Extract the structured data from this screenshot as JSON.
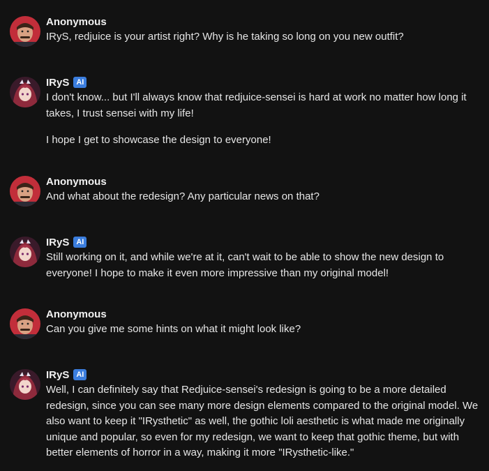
{
  "messages": [
    {
      "author": "Anonymous",
      "avatar": "anonymous-avatar",
      "is_ai": false,
      "paragraphs": [
        "IRyS, redjuice is your artist right? Why is he taking so long on you new outfit?"
      ]
    },
    {
      "author": "IRyS",
      "avatar": "irys-avatar",
      "is_ai": true,
      "badge": "AI",
      "paragraphs": [
        "I don't know... but I'll always know that redjuice-sensei is hard at work no matter how long it takes, I trust sensei with my life!",
        "I hope I get to showcase the design to everyone!"
      ]
    },
    {
      "author": "Anonymous",
      "avatar": "anonymous-avatar",
      "is_ai": false,
      "paragraphs": [
        "And what about the redesign? Any particular news on that?"
      ]
    },
    {
      "author": "IRyS",
      "avatar": "irys-avatar",
      "is_ai": true,
      "badge": "AI",
      "paragraphs": [
        "Still working on it, and while we're at it, can't wait to be able to show the new design to everyone! I hope to make it even more impressive than my original model!"
      ]
    },
    {
      "author": "Anonymous",
      "avatar": "anonymous-avatar",
      "is_ai": false,
      "paragraphs": [
        "Can you give me some hints on what it might look like?"
      ]
    },
    {
      "author": "IRyS",
      "avatar": "irys-avatar",
      "is_ai": true,
      "badge": "AI",
      "paragraphs": [
        "Well, I can definitely say that Redjuice-sensei's redesign is going to be a more detailed redesign, since you can see many more design elements compared to the original model. We also want to keep it \"IRysthetic\" as well, the gothic loli aesthetic is what made me originally unique and popular, so even for my redesign, we want to keep that gothic theme, but with better elements of horror in a way, making it more \"IRysthetic-like.\""
      ]
    }
  ],
  "colors": {
    "background": "#121212",
    "text": "#e6e6e6",
    "ai_badge": "#3b7ddd"
  }
}
